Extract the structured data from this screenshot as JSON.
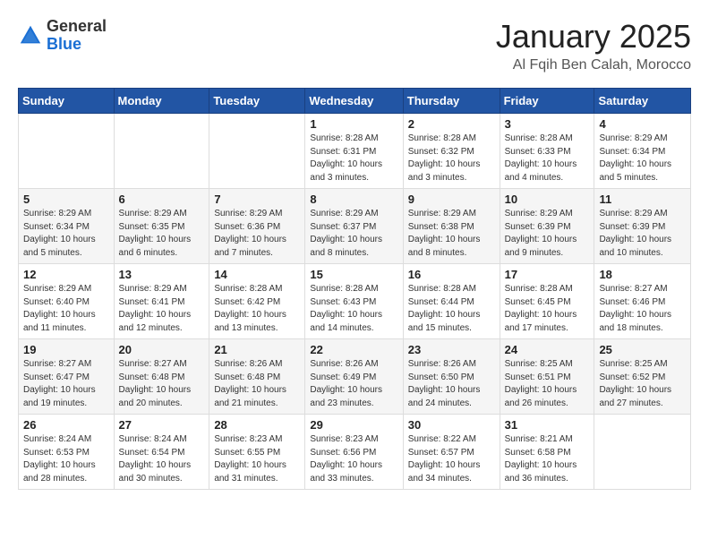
{
  "header": {
    "logo_general": "General",
    "logo_blue": "Blue",
    "month_title": "January 2025",
    "location": "Al Fqih Ben Calah, Morocco"
  },
  "days_of_week": [
    "Sunday",
    "Monday",
    "Tuesday",
    "Wednesday",
    "Thursday",
    "Friday",
    "Saturday"
  ],
  "weeks": [
    [
      {
        "day": "",
        "sunrise": "",
        "sunset": "",
        "daylight": ""
      },
      {
        "day": "",
        "sunrise": "",
        "sunset": "",
        "daylight": ""
      },
      {
        "day": "",
        "sunrise": "",
        "sunset": "",
        "daylight": ""
      },
      {
        "day": "1",
        "sunrise": "Sunrise: 8:28 AM",
        "sunset": "Sunset: 6:31 PM",
        "daylight": "Daylight: 10 hours and 3 minutes."
      },
      {
        "day": "2",
        "sunrise": "Sunrise: 8:28 AM",
        "sunset": "Sunset: 6:32 PM",
        "daylight": "Daylight: 10 hours and 3 minutes."
      },
      {
        "day": "3",
        "sunrise": "Sunrise: 8:28 AM",
        "sunset": "Sunset: 6:33 PM",
        "daylight": "Daylight: 10 hours and 4 minutes."
      },
      {
        "day": "4",
        "sunrise": "Sunrise: 8:29 AM",
        "sunset": "Sunset: 6:34 PM",
        "daylight": "Daylight: 10 hours and 5 minutes."
      }
    ],
    [
      {
        "day": "5",
        "sunrise": "Sunrise: 8:29 AM",
        "sunset": "Sunset: 6:34 PM",
        "daylight": "Daylight: 10 hours and 5 minutes."
      },
      {
        "day": "6",
        "sunrise": "Sunrise: 8:29 AM",
        "sunset": "Sunset: 6:35 PM",
        "daylight": "Daylight: 10 hours and 6 minutes."
      },
      {
        "day": "7",
        "sunrise": "Sunrise: 8:29 AM",
        "sunset": "Sunset: 6:36 PM",
        "daylight": "Daylight: 10 hours and 7 minutes."
      },
      {
        "day": "8",
        "sunrise": "Sunrise: 8:29 AM",
        "sunset": "Sunset: 6:37 PM",
        "daylight": "Daylight: 10 hours and 8 minutes."
      },
      {
        "day": "9",
        "sunrise": "Sunrise: 8:29 AM",
        "sunset": "Sunset: 6:38 PM",
        "daylight": "Daylight: 10 hours and 8 minutes."
      },
      {
        "day": "10",
        "sunrise": "Sunrise: 8:29 AM",
        "sunset": "Sunset: 6:39 PM",
        "daylight": "Daylight: 10 hours and 9 minutes."
      },
      {
        "day": "11",
        "sunrise": "Sunrise: 8:29 AM",
        "sunset": "Sunset: 6:39 PM",
        "daylight": "Daylight: 10 hours and 10 minutes."
      }
    ],
    [
      {
        "day": "12",
        "sunrise": "Sunrise: 8:29 AM",
        "sunset": "Sunset: 6:40 PM",
        "daylight": "Daylight: 10 hours and 11 minutes."
      },
      {
        "day": "13",
        "sunrise": "Sunrise: 8:29 AM",
        "sunset": "Sunset: 6:41 PM",
        "daylight": "Daylight: 10 hours and 12 minutes."
      },
      {
        "day": "14",
        "sunrise": "Sunrise: 8:28 AM",
        "sunset": "Sunset: 6:42 PM",
        "daylight": "Daylight: 10 hours and 13 minutes."
      },
      {
        "day": "15",
        "sunrise": "Sunrise: 8:28 AM",
        "sunset": "Sunset: 6:43 PM",
        "daylight": "Daylight: 10 hours and 14 minutes."
      },
      {
        "day": "16",
        "sunrise": "Sunrise: 8:28 AM",
        "sunset": "Sunset: 6:44 PM",
        "daylight": "Daylight: 10 hours and 15 minutes."
      },
      {
        "day": "17",
        "sunrise": "Sunrise: 8:28 AM",
        "sunset": "Sunset: 6:45 PM",
        "daylight": "Daylight: 10 hours and 17 minutes."
      },
      {
        "day": "18",
        "sunrise": "Sunrise: 8:27 AM",
        "sunset": "Sunset: 6:46 PM",
        "daylight": "Daylight: 10 hours and 18 minutes."
      }
    ],
    [
      {
        "day": "19",
        "sunrise": "Sunrise: 8:27 AM",
        "sunset": "Sunset: 6:47 PM",
        "daylight": "Daylight: 10 hours and 19 minutes."
      },
      {
        "day": "20",
        "sunrise": "Sunrise: 8:27 AM",
        "sunset": "Sunset: 6:48 PM",
        "daylight": "Daylight: 10 hours and 20 minutes."
      },
      {
        "day": "21",
        "sunrise": "Sunrise: 8:26 AM",
        "sunset": "Sunset: 6:48 PM",
        "daylight": "Daylight: 10 hours and 21 minutes."
      },
      {
        "day": "22",
        "sunrise": "Sunrise: 8:26 AM",
        "sunset": "Sunset: 6:49 PM",
        "daylight": "Daylight: 10 hours and 23 minutes."
      },
      {
        "day": "23",
        "sunrise": "Sunrise: 8:26 AM",
        "sunset": "Sunset: 6:50 PM",
        "daylight": "Daylight: 10 hours and 24 minutes."
      },
      {
        "day": "24",
        "sunrise": "Sunrise: 8:25 AM",
        "sunset": "Sunset: 6:51 PM",
        "daylight": "Daylight: 10 hours and 26 minutes."
      },
      {
        "day": "25",
        "sunrise": "Sunrise: 8:25 AM",
        "sunset": "Sunset: 6:52 PM",
        "daylight": "Daylight: 10 hours and 27 minutes."
      }
    ],
    [
      {
        "day": "26",
        "sunrise": "Sunrise: 8:24 AM",
        "sunset": "Sunset: 6:53 PM",
        "daylight": "Daylight: 10 hours and 28 minutes."
      },
      {
        "day": "27",
        "sunrise": "Sunrise: 8:24 AM",
        "sunset": "Sunset: 6:54 PM",
        "daylight": "Daylight: 10 hours and 30 minutes."
      },
      {
        "day": "28",
        "sunrise": "Sunrise: 8:23 AM",
        "sunset": "Sunset: 6:55 PM",
        "daylight": "Daylight: 10 hours and 31 minutes."
      },
      {
        "day": "29",
        "sunrise": "Sunrise: 8:23 AM",
        "sunset": "Sunset: 6:56 PM",
        "daylight": "Daylight: 10 hours and 33 minutes."
      },
      {
        "day": "30",
        "sunrise": "Sunrise: 8:22 AM",
        "sunset": "Sunset: 6:57 PM",
        "daylight": "Daylight: 10 hours and 34 minutes."
      },
      {
        "day": "31",
        "sunrise": "Sunrise: 8:21 AM",
        "sunset": "Sunset: 6:58 PM",
        "daylight": "Daylight: 10 hours and 36 minutes."
      },
      {
        "day": "",
        "sunrise": "",
        "sunset": "",
        "daylight": ""
      }
    ]
  ]
}
